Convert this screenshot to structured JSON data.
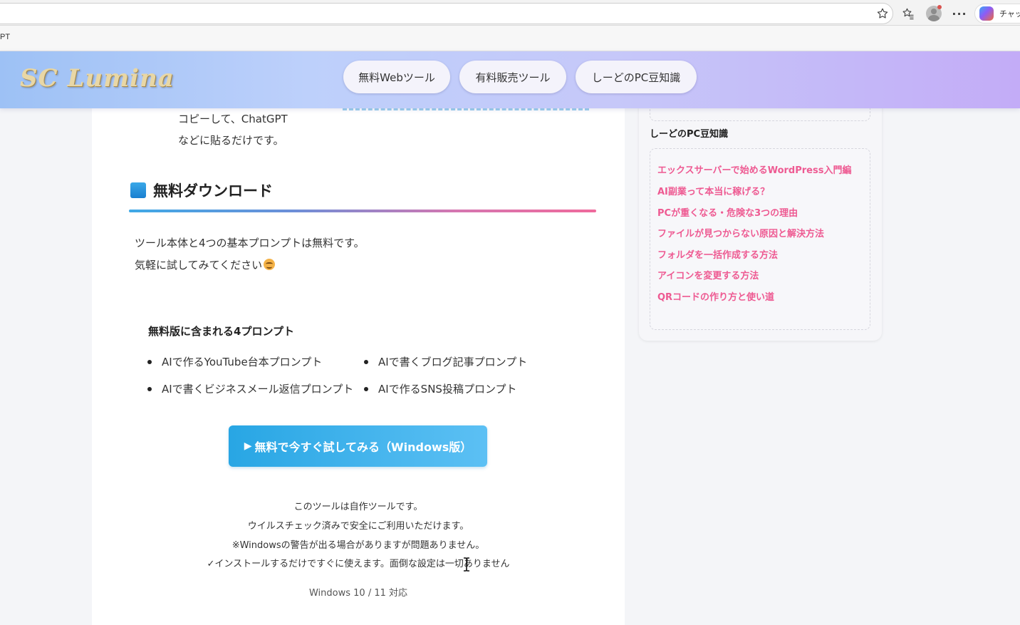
{
  "browser": {
    "bookmark_label": "PT",
    "copilot_label": "チャット",
    "more_label": "···"
  },
  "site": {
    "logo": "SC Lumina",
    "nav": [
      {
        "label": "無料Webツール"
      },
      {
        "label": "有料販売ツール"
      },
      {
        "label": "しーどのPC豆知識"
      }
    ]
  },
  "article": {
    "step_text_line1": "コピーして、ChatGPT",
    "step_text_line2": "などに貼るだけです。",
    "section_heading": "無料ダウンロード",
    "intro_line1": "ツール本体と4つの基本プロンプトは無料です。",
    "intro_line2": "気軽に試してみてください",
    "prompt_list_title": "無料版に含まれる4プロンプト",
    "prompts": [
      "AIで作るYouTube台本プロンプト",
      "AIで書くブログ記事プロンプト",
      "AIで書くビジネスメール返信プロンプト",
      "AIで作るSNS投稿プロンプト"
    ],
    "download_button": "無料で今すぐ試してみる（Windows版）",
    "notes": [
      "このツールは自作ツールです。",
      "ウイルスチェック済みで安全にご利用いただけます。",
      "※Windowsの警告が出る場合がありますが問題ありません。",
      "インストールするだけですぐに使えます。面倒な設定は一切ありません"
    ],
    "check_mark": "✓",
    "compat": "Windows 10 / 11 対応"
  },
  "sidebar": {
    "heading": "しーどのPC豆知識",
    "links": [
      "エックスサーバーで始めるWordPress入門編",
      "AI副業って本当に稼げる？",
      "PCが重くなる・危険な3つの理由",
      "ファイルが見つからない原因と解決方法",
      "フォルダを一括作成する方法",
      "アイコンを変更する方法",
      "QRコードの作り方と使い道"
    ]
  },
  "colors": {
    "accent_blue": "#28a6e4",
    "link_pink": "#ee5a92"
  }
}
